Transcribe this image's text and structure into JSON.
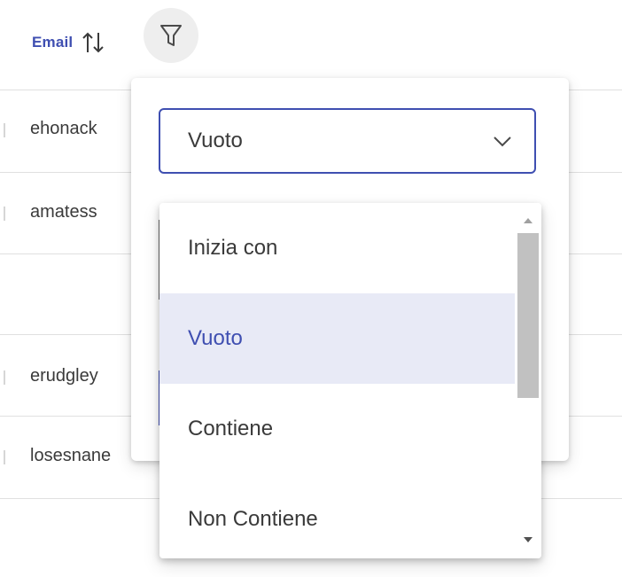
{
  "column": {
    "title": "Email"
  },
  "rows": [
    {
      "email": "ehonack"
    },
    {
      "email": "amatess"
    },
    {
      "email": ""
    },
    {
      "email": "erudgley"
    },
    {
      "email": "losesnane"
    }
  ],
  "filter": {
    "operator_selected": "Vuoto",
    "options": [
      {
        "label": "Inizia con",
        "selected": false
      },
      {
        "label": "Vuoto",
        "selected": true
      },
      {
        "label": "Contiene",
        "selected": false
      },
      {
        "label": "Non Contiene",
        "selected": false
      }
    ]
  },
  "colors": {
    "accent": "#3f4fb1",
    "selected_bg": "#e8eaf6",
    "scroll_thumb": "#c1c1c1"
  },
  "icons": {
    "sort": "sort-arrows-icon",
    "filter": "funnel-icon",
    "chevron": "chevron-down-icon"
  }
}
